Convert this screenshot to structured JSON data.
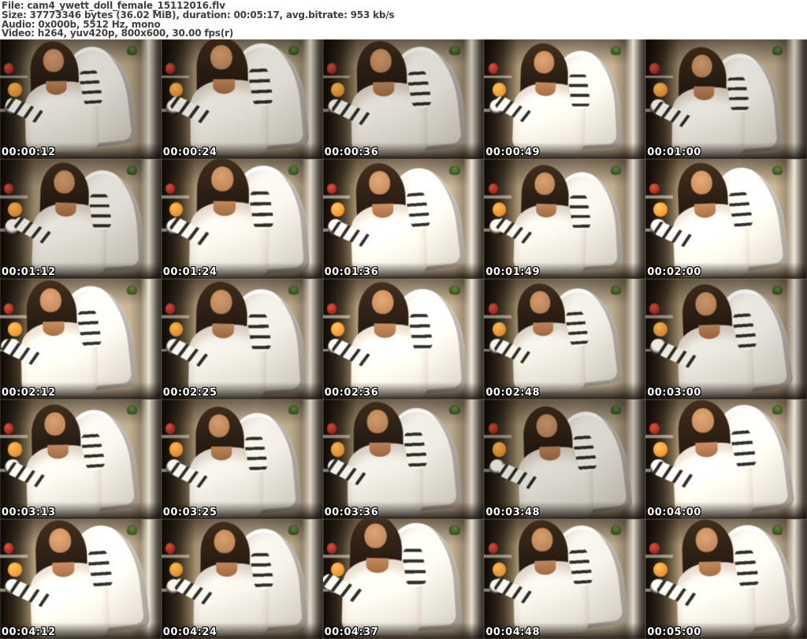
{
  "header": {
    "lines": [
      "File: cam4_ywett_doll_female_15112016.flv",
      "Size: 37773346 bytes (36.02 MiB), duration: 00:05:17, avg.bitrate: 953 kb/s",
      "Audio: 0x000b, 5512 Hz, mono",
      "Video: h264, yuv420p, 800x600, 30.00 fps(r)"
    ]
  },
  "grid": {
    "columns": 5,
    "rows": 5
  },
  "thumbnails": {
    "timestamps": [
      "00:00:12",
      "00:00:24",
      "00:00:36",
      "00:00:49",
      "00:01:00",
      "00:01:12",
      "00:01:24",
      "00:01:36",
      "00:01:49",
      "00:02:00",
      "00:02:12",
      "00:02:25",
      "00:02:36",
      "00:02:48",
      "00:03:00",
      "00:03:13",
      "00:03:25",
      "00:03:36",
      "00:03:48",
      "00:04:00",
      "00:04:12",
      "00:04:24",
      "00:04:37",
      "00:04:48",
      "00:05:00"
    ]
  },
  "colors": {
    "headertext": "#3f3f3f",
    "tstext": "#ffffff",
    "tsoutline": "#000000",
    "wall": "#bfae92",
    "chair": "#efece5",
    "hair": "#261b12",
    "skin": "#b5825a",
    "topwhite": "#f1eee6",
    "letter": "#2e2c28",
    "toyorange": "#d8892e",
    "toyred": "#8f221b",
    "plant": "#5a7a3a",
    "desk": "#d9d3c5"
  }
}
